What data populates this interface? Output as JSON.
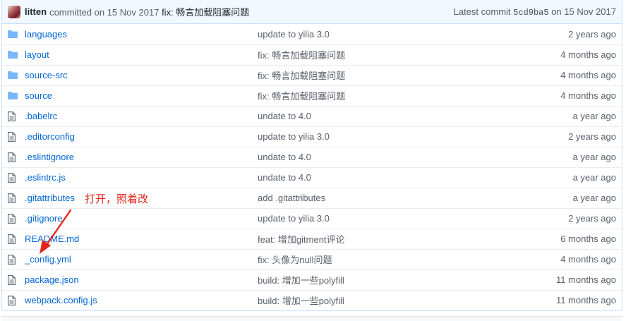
{
  "commit": {
    "author": "litten",
    "committed_text": "committed on 15 Nov 2017",
    "message": "fix: 畅言加载阻塞问题",
    "latest_label": "Latest commit",
    "sha": "5cd9ba5",
    "latest_date": "on 15 Nov 2017"
  },
  "rows": [
    {
      "type": "folder",
      "name": "languages",
      "message": "update to yilia 3.0",
      "age": "2 years ago"
    },
    {
      "type": "folder",
      "name": "layout",
      "message": "fix: 畅言加载阻塞问题",
      "age": "4 months ago"
    },
    {
      "type": "folder",
      "name": "source-src",
      "message": "fix: 畅言加载阻塞问题",
      "age": "4 months ago"
    },
    {
      "type": "folder",
      "name": "source",
      "message": "fix: 畅言加载阻塞问题",
      "age": "4 months ago"
    },
    {
      "type": "file",
      "name": ".babelrc",
      "message": "undate to 4.0",
      "age": "a year ago"
    },
    {
      "type": "file",
      "name": ".editorconfig",
      "message": "update to yilia 3.0",
      "age": "2 years ago"
    },
    {
      "type": "file",
      "name": ".eslintignore",
      "message": "undate to 4.0",
      "age": "a year ago"
    },
    {
      "type": "file",
      "name": ".eslintrc.js",
      "message": "undate to 4.0",
      "age": "a year ago"
    },
    {
      "type": "file",
      "name": ".gitattributes",
      "message": "add .gitattributes",
      "age": "a year ago"
    },
    {
      "type": "file",
      "name": ".gitignore",
      "message": "update to yilia 3.0",
      "age": "2 years ago"
    },
    {
      "type": "file",
      "name": "README.md",
      "message": "feat: 增加gitment评论",
      "age": "6 months ago"
    },
    {
      "type": "file",
      "name": "_config.yml",
      "message": "fix: 头像为null问题",
      "age": "4 months ago"
    },
    {
      "type": "file",
      "name": "package.json",
      "message": "build: 增加一些polyfill",
      "age": "11 months ago"
    },
    {
      "type": "file",
      "name": "webpack.config.js",
      "message": "build: 增加一些polyfill",
      "age": "11 months ago"
    }
  ],
  "annotation": "打开，照着改",
  "colors": {
    "link": "#0366d6",
    "folder": "#79b8ff",
    "annotation": "#e0261c"
  }
}
